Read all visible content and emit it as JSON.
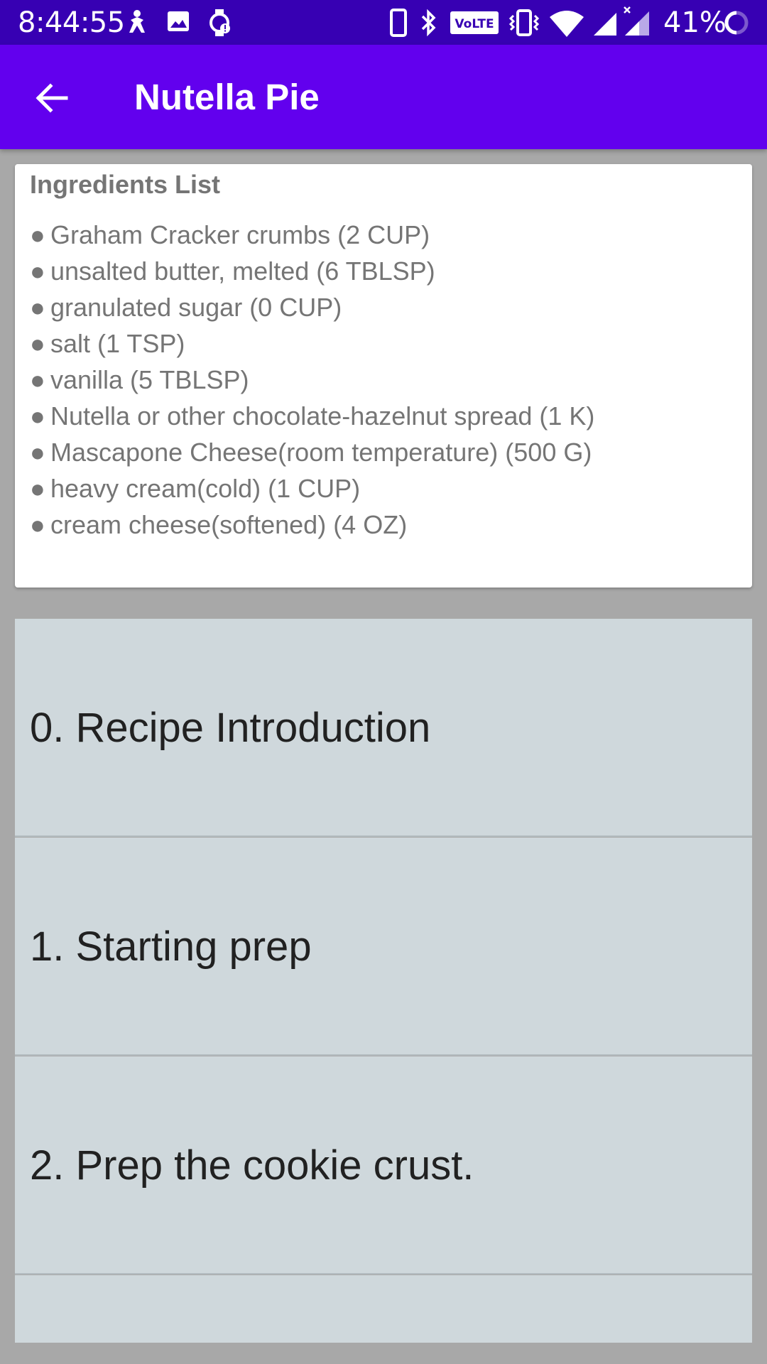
{
  "status_bar": {
    "time": "8:44:55",
    "battery": "41%",
    "icons": [
      "accessibility-icon",
      "image-icon",
      "watch-alert-icon",
      "phone-icon",
      "bluetooth-icon",
      "volte-icon",
      "vibrate-icon",
      "wifi-icon",
      "signal-icon",
      "signal-x-icon",
      "battery-ring-icon"
    ],
    "volte_label": "VoLTE",
    "color": "#3700b3"
  },
  "app_bar": {
    "title": "Nutella Pie",
    "back_icon": "arrow-back-icon",
    "color": "#6200ee"
  },
  "ingredients": {
    "title": "Ingredients List",
    "bullet": "●",
    "items": [
      "Graham Cracker crumbs (2 CUP)",
      "unsalted butter, melted (6 TBLSP)",
      "granulated sugar (0 CUP)",
      "salt (1 TSP)",
      "vanilla (5 TBLSP)",
      "Nutella or other chocolate-hazelnut spread (1 K)",
      "Mascapone Cheese(room temperature) (500 G)",
      "heavy cream(cold) (1 CUP)",
      "cream cheese(softened) (4 OZ)"
    ]
  },
  "steps": [
    "0. Recipe Introduction",
    "1. Starting prep",
    "2. Prep the cookie crust.",
    ""
  ],
  "colors": {
    "background": "#a8a8a8",
    "card": "#ffffff",
    "step_background": "#cfd8dc",
    "ingredient_text": "#757575",
    "step_text": "#212121"
  }
}
